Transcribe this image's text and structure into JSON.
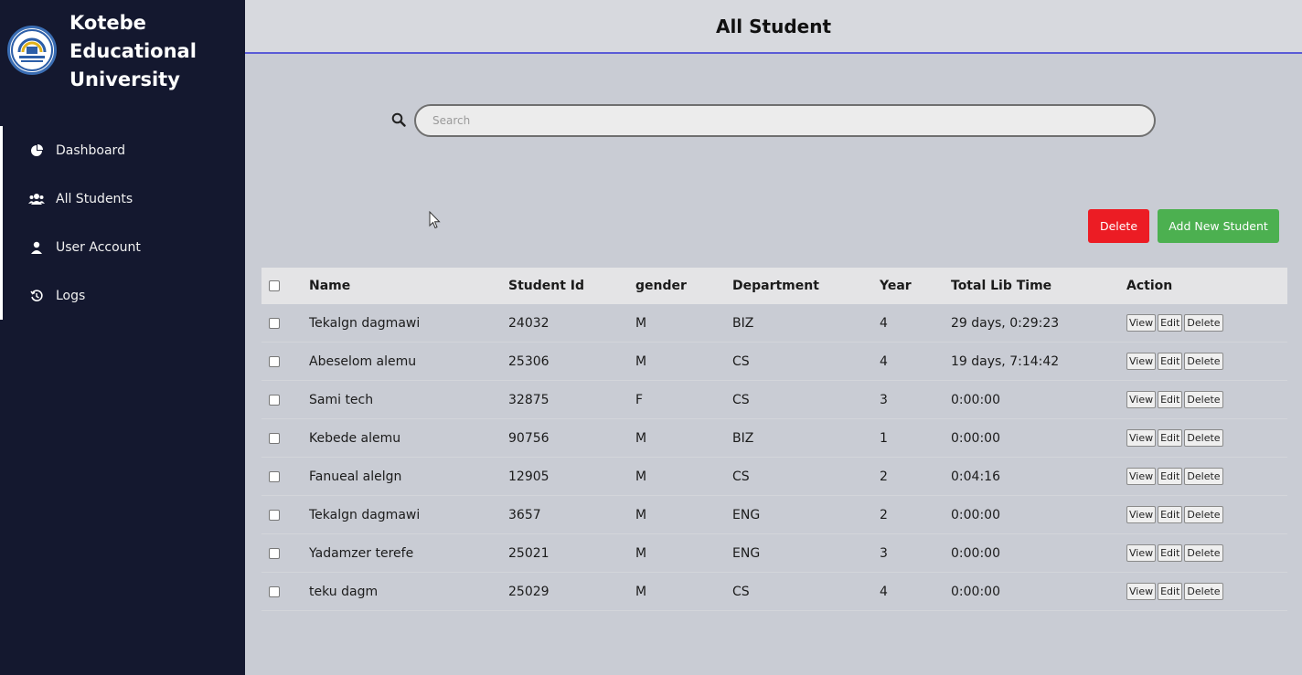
{
  "sidebar": {
    "brand": {
      "line1": "Kotebe",
      "line2": "Educational",
      "line3": "University"
    },
    "items": [
      {
        "label": "Dashboard",
        "icon": "dashboard-icon"
      },
      {
        "label": "All Students",
        "icon": "users-icon"
      },
      {
        "label": "User Account",
        "icon": "user-icon"
      },
      {
        "label": "Logs",
        "icon": "history-icon"
      }
    ]
  },
  "header": {
    "title": "All Student"
  },
  "search": {
    "placeholder": "Search",
    "value": ""
  },
  "actions": {
    "delete_label": "Delete",
    "add_label": "Add New Student"
  },
  "table": {
    "columns": {
      "name": "Name",
      "id": "Student Id",
      "gender": "gender",
      "department": "Department",
      "year": "Year",
      "time": "Total Lib Time",
      "action": "Action"
    },
    "row_actions": {
      "view": "View",
      "edit": "Edit",
      "delete": "Delete"
    },
    "rows": [
      {
        "name": "Tekalgn dagmawi",
        "id": "24032",
        "gender": "M",
        "department": "BIZ",
        "year": "4",
        "time": "29 days, 0:29:23"
      },
      {
        "name": "Abeselom alemu",
        "id": "25306",
        "gender": "M",
        "department": "CS",
        "year": "4",
        "time": "19 days, 7:14:42"
      },
      {
        "name": "Sami tech",
        "id": "32875",
        "gender": "F",
        "department": "CS",
        "year": "3",
        "time": "0:00:00"
      },
      {
        "name": "Kebede alemu",
        "id": "90756",
        "gender": "M",
        "department": "BIZ",
        "year": "1",
        "time": "0:00:00"
      },
      {
        "name": "Fanueal alelgn",
        "id": "12905",
        "gender": "M",
        "department": "CS",
        "year": "2",
        "time": "0:04:16"
      },
      {
        "name": "Tekalgn dagmawi",
        "id": "3657",
        "gender": "M",
        "department": "ENG",
        "year": "2",
        "time": "0:00:00"
      },
      {
        "name": "Yadamzer terefe",
        "id": "25021",
        "gender": "M",
        "department": "ENG",
        "year": "3",
        "time": "0:00:00"
      },
      {
        "name": "teku dagm",
        "id": "25029",
        "gender": "M",
        "department": "CS",
        "year": "4",
        "time": "0:00:00"
      }
    ]
  },
  "colors": {
    "sidebar": "#14182f",
    "accent": "#5a5bd6",
    "delete": "#ec1c24",
    "add": "#4cb050"
  }
}
